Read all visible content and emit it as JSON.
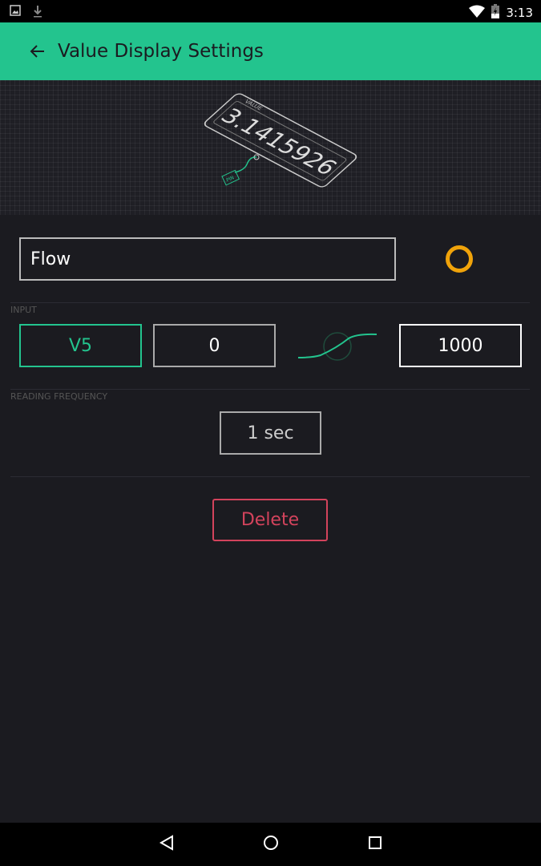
{
  "status_bar": {
    "time": "3:13"
  },
  "app_bar": {
    "title": "Value Display Settings"
  },
  "hero": {
    "label": "VALUE",
    "value": "3.1415926",
    "pin": "PIN"
  },
  "name_field": {
    "value": "Flow"
  },
  "color_accent": "#f0a30a",
  "input": {
    "label": "INPUT",
    "pin": "V5",
    "min": "0",
    "max": "1000"
  },
  "frequency": {
    "label": "READING FREQUENCY",
    "value": "1 sec"
  },
  "delete_label": "Delete",
  "colors": {
    "primary": "#23c48e",
    "danger": "#d3435c",
    "background": "#1b1b20"
  }
}
